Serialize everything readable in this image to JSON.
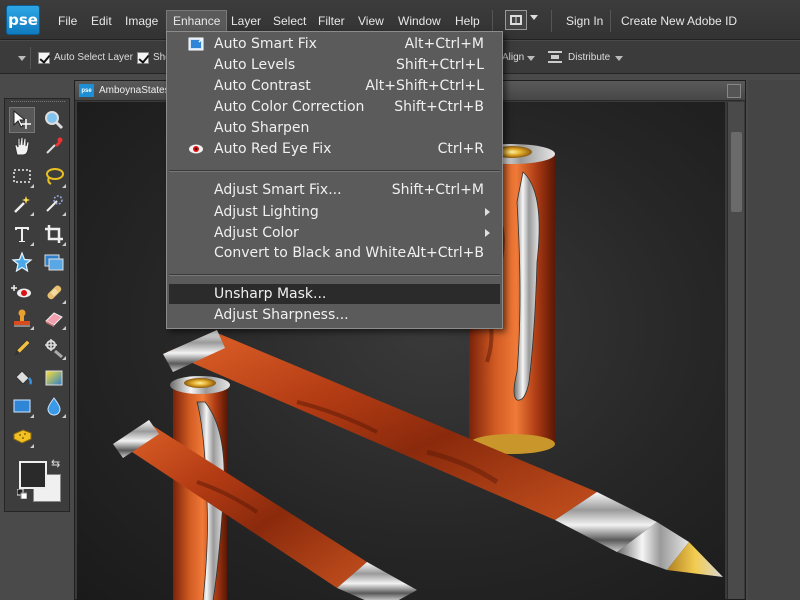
{
  "app": {
    "logo_text": "pse"
  },
  "menubar": {
    "items": [
      {
        "label": "File"
      },
      {
        "label": "Edit"
      },
      {
        "label": "Image"
      },
      {
        "label": "Enhance"
      },
      {
        "label": "Layer"
      },
      {
        "label": "Select"
      },
      {
        "label": "Filter"
      },
      {
        "label": "View"
      },
      {
        "label": "Window"
      },
      {
        "label": "Help"
      }
    ],
    "sign_in": "Sign In",
    "create_id": "Create New Adobe ID"
  },
  "options": {
    "auto_select_layer": "Auto Select Layer",
    "show_label": "Sho",
    "align": "Align",
    "distribute": "Distribute"
  },
  "document": {
    "title": "AmboynaStates",
    "badge": "pse"
  },
  "enhance_menu": {
    "group1": [
      {
        "label": "Auto Smart Fix",
        "shortcut": "Alt+Ctrl+M",
        "icon": "auto-smart-fix-icon"
      },
      {
        "label": "Auto Levels",
        "shortcut": "Shift+Ctrl+L"
      },
      {
        "label": "Auto Contrast",
        "shortcut": "Alt+Shift+Ctrl+L"
      },
      {
        "label": "Auto Color Correction",
        "shortcut": "Shift+Ctrl+B"
      },
      {
        "label": "Auto Sharpen",
        "shortcut": ""
      },
      {
        "label": "Auto Red Eye Fix",
        "shortcut": "Ctrl+R",
        "icon": "red-eye-icon"
      }
    ],
    "group2": [
      {
        "label": "Adjust Smart Fix...",
        "shortcut": "Shift+Ctrl+M"
      },
      {
        "label": "Adjust Lighting",
        "submenu": true
      },
      {
        "label": "Adjust Color",
        "submenu": true
      },
      {
        "label": "Convert to Black and White...",
        "shortcut": "Alt+Ctrl+B"
      }
    ],
    "group3": [
      {
        "label": "Unsharp Mask...",
        "highlighted": true
      },
      {
        "label": "Adjust Sharpness..."
      }
    ]
  },
  "colors": {
    "accent": "#1d8fd4",
    "menu_bg": "#5b5b5b",
    "menu_highlight": "#2b2b2b",
    "wood": "#b4401a",
    "chrome": "#cfcfcf",
    "gold": "#d8a82a"
  }
}
